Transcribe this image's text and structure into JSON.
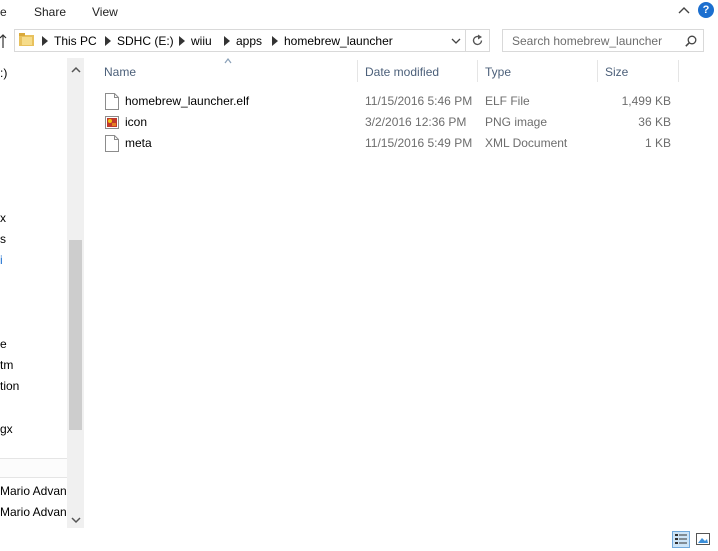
{
  "ribbon": {
    "tabs": [
      "e",
      "Share",
      "View"
    ],
    "help_label": "?"
  },
  "address": {
    "breadcrumbs": [
      "This PC",
      "SDHC (E:)",
      "wiiu",
      "apps",
      "homebrew_launcher"
    ]
  },
  "search": {
    "placeholder": "Search homebrew_launcher"
  },
  "nav_pane": {
    "items": [
      ":)",
      "x",
      "s",
      "i",
      "e",
      "tm",
      "tion",
      "gx",
      "Mario Advan",
      "Mario Advan"
    ]
  },
  "file_list": {
    "columns": [
      "Name",
      "Date modified",
      "Type",
      "Size"
    ],
    "rows": [
      {
        "name": "homebrew_launcher.elf",
        "date": "11/15/2016 5:46 PM",
        "type": "ELF File",
        "size": "1,499 KB",
        "icon": "file-icon"
      },
      {
        "name": "icon",
        "date": "3/2/2016 12:36 PM",
        "type": "PNG image",
        "size": "36 KB",
        "icon": "image-icon"
      },
      {
        "name": "meta",
        "date": "11/15/2016 5:49 PM",
        "type": "XML Document",
        "size": "1 KB",
        "icon": "file-icon"
      }
    ]
  },
  "colors": {
    "accent": "#1c6fcf",
    "header_text": "#4c607a",
    "meta_text": "#6d6d6d"
  }
}
